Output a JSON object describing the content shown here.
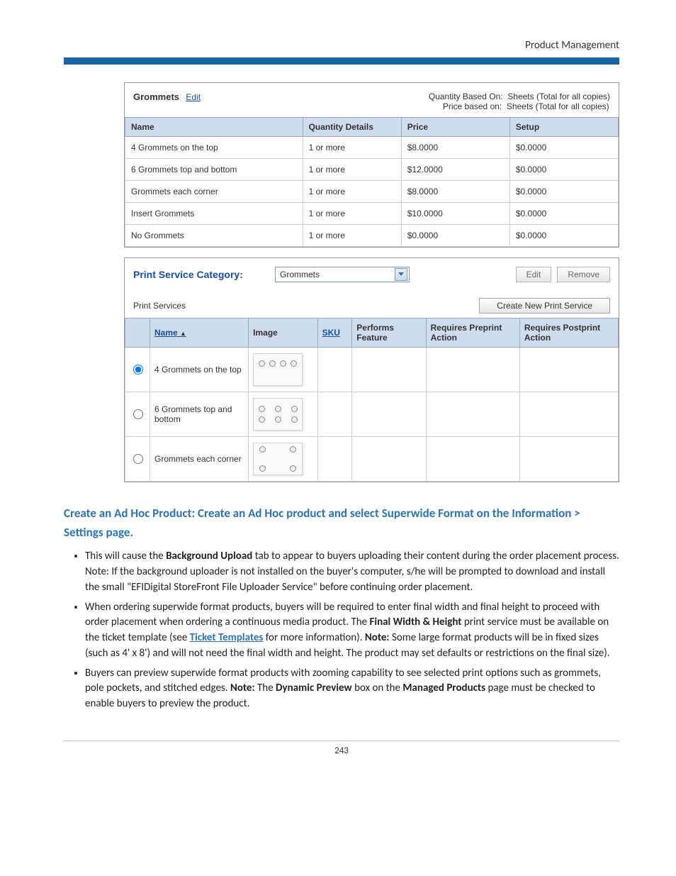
{
  "header": {
    "doc_title": "Product Management"
  },
  "panel1": {
    "title": "Grommets",
    "edit": "Edit",
    "qty_basis_label": "Quantity Based On:",
    "qty_basis_value": "Sheets (Total for all copies)",
    "price_basis_label": "Price based on:",
    "price_basis_value": "Sheets (Total for all copies)",
    "cols": {
      "name": "Name",
      "qty": "Quantity Details",
      "price": "Price",
      "setup": "Setup"
    },
    "rows": [
      {
        "name": "4 Grommets on the top",
        "qty": "1 or more",
        "price": "$8.0000",
        "setup": "$0.0000"
      },
      {
        "name": "6 Grommets top and bottom",
        "qty": "1 or more",
        "price": "$12.0000",
        "setup": "$0.0000"
      },
      {
        "name": "Grommets each corner",
        "qty": "1 or more",
        "price": "$8.0000",
        "setup": "$0.0000"
      },
      {
        "name": "Insert Grommets",
        "qty": "1 or more",
        "price": "$10.0000",
        "setup": "$0.0000"
      },
      {
        "name": "No Grommets",
        "qty": "1 or more",
        "price": "$0.0000",
        "setup": "$0.0000"
      }
    ]
  },
  "panel2": {
    "category_label": "Print Service Category:",
    "category_value": "Grommets",
    "edit_btn": "Edit",
    "remove_btn": "Remove",
    "sub_label": "Print Services",
    "create_btn": "Create New Print Service",
    "cols": {
      "name": "Name",
      "image": "Image",
      "sku": "SKU",
      "perf": "Performs Feature",
      "pre": "Requires Preprint Action",
      "post": "Requires Postprint Action"
    },
    "sort_glyph": "▲",
    "rows": [
      {
        "name": "4 Grommets on the top"
      },
      {
        "name": "6 Grommets top and bottom"
      },
      {
        "name": "Grommets each corner"
      }
    ]
  },
  "body": {
    "heading": "Create an Ad Hoc Product: Create an Ad Hoc product and select Superwide Format on the Information > Settings page.",
    "b1_a": "This will cause the ",
    "b1_bold": "Background Upload",
    "b1_b": " tab to appear to buyers uploading their content during the order placement process. Note: If the background uploader is not installed on the buyer's computer, s/he will be prompted to download and install the small \"EFIDigital StoreFront File Uploader Service\" before continuing order placement.",
    "b2_a": "When ordering superwide format products, buyers will be required to enter final width and final height to proceed with order placement when ordering a continuous media product. The ",
    "b2_bold1": "Final Width & Height",
    "b2_b": " print service must be available on the ticket template (see ",
    "b2_link": "Ticket Templates",
    "b2_c": " for more information). ",
    "b2_bold2": "Note:",
    "b2_d": " Some large format products will be in fixed sizes (such as 4' x 8') and will not need the final width and height. The product may set defaults or restrictions on the final size).",
    "b3_a": "Buyers can preview superwide format products with zooming capability to see selected print options such as grommets, pole pockets, and stitched edges. ",
    "b3_bold1": "Note:",
    "b3_b": " The ",
    "b3_bold2": "Dynamic Preview",
    "b3_c": " box on the ",
    "b3_bold3": "Managed Products",
    "b3_d": " page must be checked to enable buyers to preview the product."
  },
  "footer": {
    "page": "243"
  }
}
